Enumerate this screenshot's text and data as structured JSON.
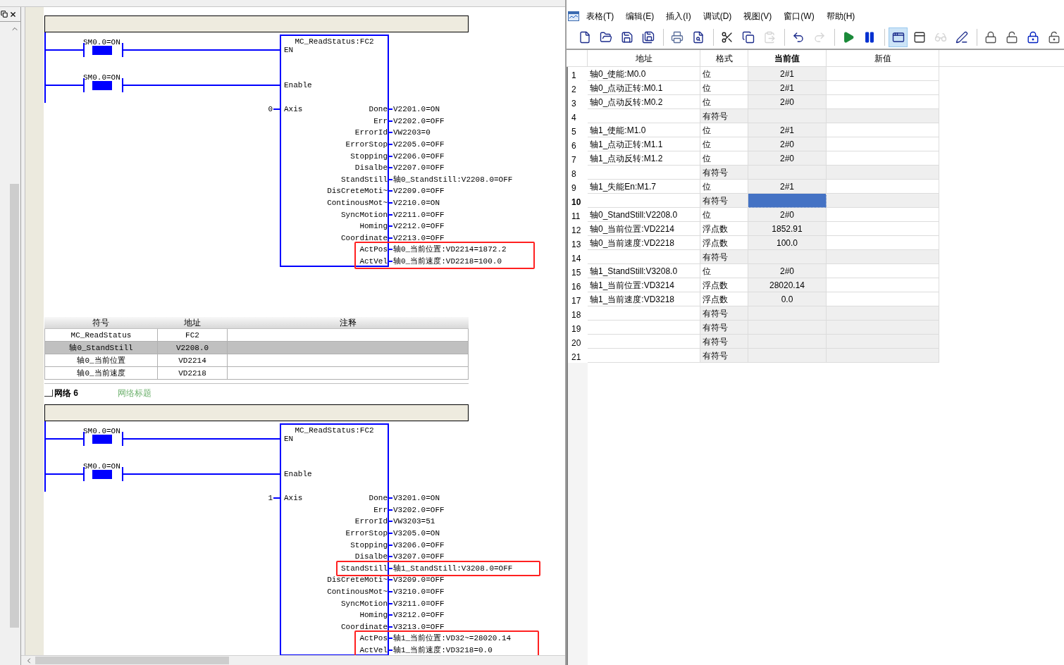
{
  "networks": [
    {
      "contacts": [
        {
          "label": "SM0.0=ON",
          "on": true
        },
        {
          "label": "SM0.0=ON",
          "on": true
        }
      ],
      "block": {
        "title": "MC_ReadStatus:FC2",
        "inputs": [
          "EN",
          "Enable"
        ],
        "axis_pin": "Axis",
        "axis_value": "0"
      },
      "outputs": [
        {
          "pin": "Done",
          "value": "V2201.0=ON",
          "highlighted": false
        },
        {
          "pin": "Err",
          "value": "V2202.0=OFF",
          "highlighted": false
        },
        {
          "pin": "ErrorId",
          "value": "VW2203=0",
          "highlighted": false
        },
        {
          "pin": "ErrorStop",
          "value": "V2205.0=OFF",
          "highlighted": false
        },
        {
          "pin": "Stopping",
          "value": "V2206.0=OFF",
          "highlighted": false
        },
        {
          "pin": "Disalbe",
          "value": "V2207.0=OFF",
          "highlighted": false
        },
        {
          "pin": "StandStill",
          "value": "轴0_StandStill:V2208.0=OFF",
          "highlighted": false
        },
        {
          "pin": "DisCreteMoti~",
          "value": "V2209.0=OFF",
          "highlighted": false
        },
        {
          "pin": "ContinousMot~",
          "value": "V2210.0=ON",
          "highlighted": false
        },
        {
          "pin": "SyncMotion",
          "value": "V2211.0=OFF",
          "highlighted": false
        },
        {
          "pin": "Homing",
          "value": "V2212.0=OFF",
          "highlighted": false
        },
        {
          "pin": "Coordinate",
          "value": "V2213.0=OFF",
          "highlighted": false
        },
        {
          "pin": "ActPos",
          "value": "轴0_当前位置:VD2214=1872.2",
          "highlighted": true
        },
        {
          "pin": "ActVel",
          "value": "轴0_当前速度:VD2218=100.0",
          "highlighted": true
        }
      ],
      "symbol_table": {
        "columns": [
          "符号",
          "地址",
          "注释"
        ],
        "rows": [
          {
            "symbol": "MC_ReadStatus",
            "address": "FC2",
            "selected": false
          },
          {
            "symbol": "轴0_StandStill",
            "address": "V2208.0",
            "selected": true
          },
          {
            "symbol": "轴0_当前位置",
            "address": "VD2214",
            "selected": false
          },
          {
            "symbol": "轴0_当前速度",
            "address": "VD2218",
            "selected": false
          }
        ]
      }
    },
    {
      "header": {
        "label": "网络 6",
        "title": "网络标题"
      },
      "contacts": [
        {
          "label": "SM0.0=ON",
          "on": true
        },
        {
          "label": "SM0.0=ON",
          "on": true
        }
      ],
      "block": {
        "title": "MC_ReadStatus:FC2",
        "inputs": [
          "EN",
          "Enable"
        ],
        "axis_pin": "Axis",
        "axis_value": "1"
      },
      "outputs": [
        {
          "pin": "Done",
          "value": "V3201.0=ON",
          "highlighted": false
        },
        {
          "pin": "Err",
          "value": "V3202.0=OFF",
          "highlighted": false
        },
        {
          "pin": "ErrorId",
          "value": "VW3203=51",
          "highlighted": false
        },
        {
          "pin": "ErrorStop",
          "value": "V3205.0=ON",
          "highlighted": false
        },
        {
          "pin": "Stopping",
          "value": "V3206.0=OFF",
          "highlighted": false
        },
        {
          "pin": "Disalbe",
          "value": "V3207.0=OFF",
          "highlighted": false
        },
        {
          "pin": "StandStill",
          "value": "轴1_StandStill:V3208.0=OFF",
          "highlighted": true
        },
        {
          "pin": "DisCreteMoti~",
          "value": "V3209.0=OFF",
          "highlighted": false
        },
        {
          "pin": "ContinousMot~",
          "value": "V3210.0=OFF",
          "highlighted": false
        },
        {
          "pin": "SyncMotion",
          "value": "V3211.0=OFF",
          "highlighted": false
        },
        {
          "pin": "Homing",
          "value": "V3212.0=OFF",
          "highlighted": false
        },
        {
          "pin": "Coordinate",
          "value": "V3213.0=OFF",
          "highlighted": false
        },
        {
          "pin": "ActPos",
          "value": "轴1_当前位置:VD32~=28020.14",
          "highlighted": true
        },
        {
          "pin": "ActVel",
          "value": "轴1_当前速度:VD3218=0.0",
          "highlighted": true
        }
      ]
    }
  ],
  "status_chart": {
    "menu": [
      "表格(T)",
      "编辑(E)",
      "插入(I)",
      "调试(D)",
      "视图(V)",
      "窗口(W)",
      "帮助(H)"
    ],
    "toolbar": [
      [
        {
          "kind": "new",
          "selected": false,
          "disabled": false
        },
        {
          "kind": "open",
          "selected": false,
          "disabled": false
        },
        {
          "kind": "save",
          "selected": false,
          "disabled": false
        },
        {
          "kind": "save_all",
          "selected": false,
          "disabled": false
        }
      ],
      [
        {
          "kind": "print",
          "selected": false,
          "disabled": false
        },
        {
          "kind": "preview",
          "selected": false,
          "disabled": false
        }
      ],
      [
        {
          "kind": "cut",
          "selected": false,
          "disabled": false
        },
        {
          "kind": "copy",
          "selected": false,
          "disabled": false
        },
        {
          "kind": "paste",
          "selected": false,
          "disabled": true
        }
      ],
      [
        {
          "kind": "undo",
          "selected": false,
          "disabled": false
        },
        {
          "kind": "redo",
          "selected": false,
          "disabled": true
        }
      ],
      [
        {
          "kind": "run",
          "selected": false,
          "disabled": false
        },
        {
          "kind": "pause",
          "selected": false,
          "disabled": false
        }
      ],
      [
        {
          "kind": "chart_status",
          "selected": true,
          "disabled": false
        },
        {
          "kind": "single_read",
          "selected": false,
          "disabled": false
        },
        {
          "kind": "glasses",
          "selected": false,
          "disabled": true
        },
        {
          "kind": "pencil",
          "selected": false,
          "disabled": false
        }
      ],
      [
        {
          "kind": "lock",
          "selected": false,
          "disabled": false
        },
        {
          "kind": "unlock",
          "selected": false,
          "disabled": false
        },
        {
          "kind": "force",
          "selected": false,
          "disabled": false
        },
        {
          "kind": "unforce",
          "selected": false,
          "disabled": false
        }
      ]
    ],
    "columns": [
      "地址",
      "格式",
      "当前值",
      "新值"
    ],
    "rows": [
      {
        "number": "1",
        "address": "轴0_使能:M0.0",
        "format": "位",
        "current": "2#1",
        "selected": false
      },
      {
        "number": "2",
        "address": "轴0_点动正转:M0.1",
        "format": "位",
        "current": "2#1",
        "selected": false
      },
      {
        "number": "3",
        "address": "轴0_点动反转:M0.2",
        "format": "位",
        "current": "2#0",
        "selected": false
      },
      {
        "number": "4",
        "format": "有符号",
        "selected": false
      },
      {
        "number": "5",
        "address": "轴1_使能:M1.0",
        "format": "位",
        "current": "2#1",
        "selected": false
      },
      {
        "number": "6",
        "address": "轴1_点动正转:M1.1",
        "format": "位",
        "current": "2#0",
        "selected": false
      },
      {
        "number": "7",
        "address": "轴1_点动反转:M1.2",
        "format": "位",
        "current": "2#0",
        "selected": false
      },
      {
        "number": "8",
        "format": "有符号",
        "selected": false
      },
      {
        "number": "9",
        "address": "轴1_失能En:M1.7",
        "format": "位",
        "current": "2#1",
        "selected": false
      },
      {
        "number": "10",
        "format": "有符号",
        "selected": true
      },
      {
        "number": "11",
        "address": "轴0_StandStill:V2208.0",
        "format": "位",
        "current": "2#0",
        "selected": false
      },
      {
        "number": "12",
        "address": "轴0_当前位置:VD2214",
        "format": "浮点数",
        "current": "1852.91",
        "selected": false
      },
      {
        "number": "13",
        "address": "轴0_当前速度:VD2218",
        "format": "浮点数",
        "current": "100.0",
        "selected": false
      },
      {
        "number": "14",
        "format": "有符号",
        "selected": false
      },
      {
        "number": "15",
        "address": "轴1_StandStill:V3208.0",
        "format": "位",
        "current": "2#0",
        "selected": false
      },
      {
        "number": "16",
        "address": "轴1_当前位置:VD3214",
        "format": "浮点数",
        "current": "28020.14",
        "selected": false
      },
      {
        "number": "17",
        "address": "轴1_当前速度:VD3218",
        "format": "浮点数",
        "current": "0.0",
        "selected": false
      },
      {
        "number": "18",
        "format": "有符号",
        "selected": false
      },
      {
        "number": "19",
        "format": "有符号",
        "selected": false
      },
      {
        "number": "20",
        "format": "有符号",
        "selected": false
      },
      {
        "number": "21",
        "format": "有符号",
        "selected": false
      }
    ]
  }
}
